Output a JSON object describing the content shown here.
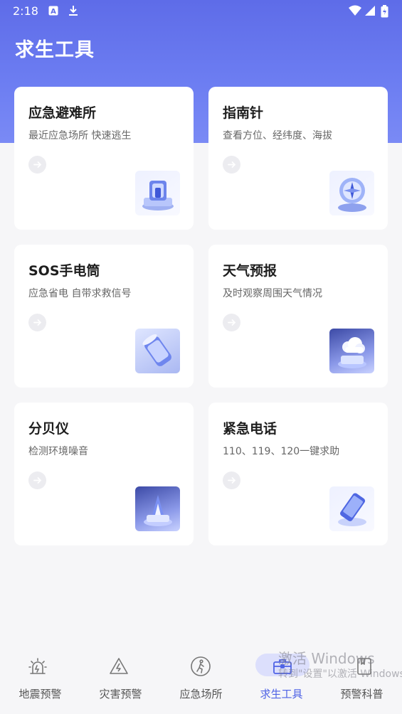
{
  "status_bar": {
    "time": "2:18",
    "icons": [
      "a-notification-icon",
      "download-icon",
      "wifi-icon",
      "signal-icon",
      "battery-icon"
    ]
  },
  "header": {
    "title": "求生工具"
  },
  "cards": [
    {
      "title": "应急避难所",
      "subtitle": "最近应急场所 快速逃生",
      "icon": "shelter-icon"
    },
    {
      "title": "指南针",
      "subtitle": "查看方位、经纬度、海拔",
      "icon": "compass-icon"
    },
    {
      "title": "SOS手电筒",
      "subtitle": "应急省电 自带求救信号",
      "icon": "flashlight-icon"
    },
    {
      "title": "天气预报",
      "subtitle": "及时观察周围天气情况",
      "icon": "weather-icon"
    },
    {
      "title": "分贝仪",
      "subtitle": "检测环境噪音",
      "icon": "decibel-meter-icon"
    },
    {
      "title": "紧急电话",
      "subtitle": "110、119、120一键求助",
      "icon": "emergency-phone-icon"
    }
  ],
  "tabbar": {
    "items": [
      {
        "label": "地震预警",
        "icon": "earthquake-alert-icon"
      },
      {
        "label": "灾害预警",
        "icon": "disaster-warning-icon"
      },
      {
        "label": "应急场所",
        "icon": "emergency-place-icon"
      },
      {
        "label": "求生工具",
        "icon": "survival-toolbox-icon",
        "active": true
      },
      {
        "label": "预警科普",
        "icon": "science-book-icon"
      }
    ]
  },
  "watermark": {
    "line1": "激活 Windows",
    "line2": "转到\"设置\"以激活 Windows。"
  },
  "colors": {
    "header": "#6373ed",
    "active_tab": "#4f63e5",
    "background": "#f6f6f8"
  }
}
